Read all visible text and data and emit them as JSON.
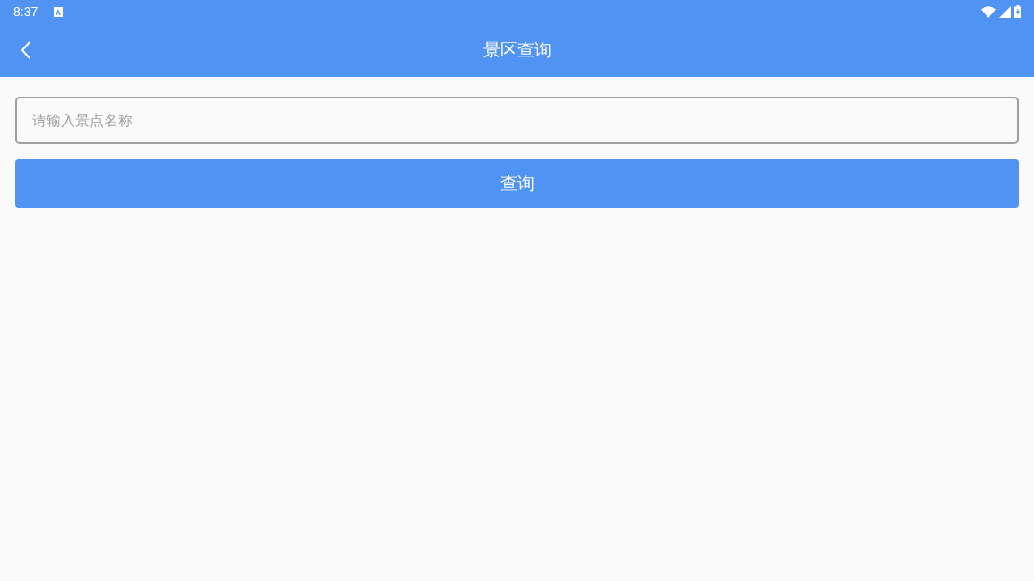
{
  "status_bar": {
    "time": "8:37"
  },
  "toolbar": {
    "title": "景区查询"
  },
  "search": {
    "placeholder": "请输入景点名称"
  },
  "button": {
    "label": "查询"
  }
}
